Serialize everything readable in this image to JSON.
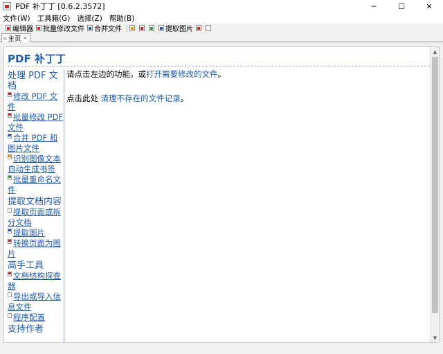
{
  "window": {
    "title": "PDF 补丁丁 [0.6.2.3572]",
    "minimize": "─",
    "maximize": "☐",
    "close": "✕"
  },
  "menubar": {
    "items": [
      "文件(W)",
      "工具箱(G)",
      "选择(Z)",
      "帮助(B)"
    ]
  },
  "toolbar": {
    "editor": "编辑器",
    "batch_modify": "批量修改文件",
    "merge": "合并文件",
    "extract_images": "提取图片"
  },
  "tabs": {
    "home": "主页",
    "pin": "⌂",
    "close": "×"
  },
  "page": {
    "title": "PDF 补丁丁"
  },
  "sidebar": {
    "sections": [
      {
        "heading": "处理 PDF 文档",
        "links": [
          "修改 PDF 文件",
          "批量修改 PDF 文件",
          "合并 PDF 和图片文件",
          "识别图像文本",
          "自动生成书签",
          "批量重命名文件"
        ]
      },
      {
        "heading": "提取文档内容",
        "links": [
          "提取页面或拆分文档",
          "提取图片",
          "转换页面为图片"
        ]
      },
      {
        "heading": "高手工具",
        "links": [
          "文档结构探查器",
          "导出或导入信息文件",
          "程序配置"
        ]
      },
      {
        "heading": "支持作者",
        "links": []
      }
    ]
  },
  "main": {
    "line1_prefix": "请点击左边的功能，或",
    "line1_link": "打开需要修改的文件",
    "line1_suffix": "。",
    "line2_prefix": "点击此处 ",
    "line2_link": "清理不存在的文件记录",
    "line2_suffix": "。"
  },
  "scrollbar": {
    "up": "▲",
    "down": "▼"
  }
}
